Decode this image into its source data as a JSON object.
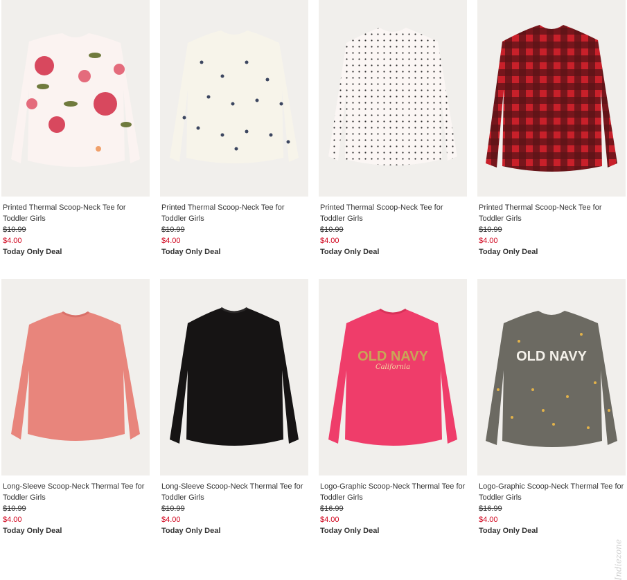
{
  "products": [
    {
      "title": "Printed Thermal Scoop-Neck Tee for Toddler Girls",
      "price_original": "$10.99",
      "price_sale": "$4.00",
      "deal": "Today Only Deal",
      "image": "floral-shirt",
      "colors": {
        "base": "#fbf3f1",
        "accent": "#d8485e",
        "leaf": "#6f7a3d"
      }
    },
    {
      "title": "Printed Thermal Scoop-Neck Tee for Toddler Girls",
      "price_original": "$10.99",
      "price_sale": "$4.00",
      "deal": "Today Only Deal",
      "image": "ditsy-print-shirt",
      "colors": {
        "base": "#f7f4ea",
        "accent": "#3c4660"
      }
    },
    {
      "title": "Printed Thermal Scoop-Neck Tee for Toddler Girls",
      "price_original": "$10.99",
      "price_sale": "$4.00",
      "deal": "Today Only Deal",
      "image": "polka-dot-shirt",
      "colors": {
        "base": "#fbf6f4",
        "accent": "#2a2a2a"
      }
    },
    {
      "title": "Printed Thermal Scoop-Neck Tee for Toddler Girls",
      "price_original": "$10.99",
      "price_sale": "$4.00",
      "deal": "Today Only Deal",
      "image": "buffalo-plaid-shirt",
      "colors": {
        "base": "#c8202a",
        "accent": "#2a0f10"
      }
    },
    {
      "title": "Long-Sleeve Scoop-Neck Thermal Tee for Toddler Girls",
      "price_original": "$10.99",
      "price_sale": "$4.00",
      "deal": "Today Only Deal",
      "image": "pink-solid-shirt",
      "colors": {
        "base": "#e8857c"
      }
    },
    {
      "title": "Long-Sleeve Scoop-Neck Thermal Tee for Toddler Girls",
      "price_original": "$10.99",
      "price_sale": "$4.00",
      "deal": "Today Only Deal",
      "image": "black-solid-shirt",
      "colors": {
        "base": "#161414"
      }
    },
    {
      "title": "Logo-Graphic Scoop-Neck Thermal Tee for Toddler Girls",
      "price_original": "$16.99",
      "price_sale": "$4.00",
      "deal": "Today Only Deal",
      "image": "logo-pink-shirt",
      "colors": {
        "base": "#ef3d6a",
        "accent": "#c8a657"
      },
      "logo_text": "OLD NAVY",
      "logo_sub": "California"
    },
    {
      "title": "Logo-Graphic Scoop-Neck Thermal Tee for Toddler Girls",
      "price_original": "$16.99",
      "price_sale": "$4.00",
      "deal": "Today Only Deal",
      "image": "logo-grey-stars-shirt",
      "colors": {
        "base": "#6c6a62",
        "accent": "#e2b24a"
      },
      "logo_text": "OLD NAVY"
    }
  ],
  "watermark": "Indiezone"
}
